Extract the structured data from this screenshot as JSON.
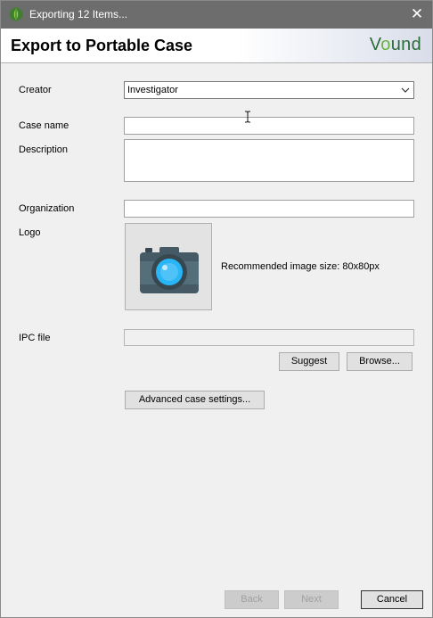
{
  "window": {
    "title": "Exporting 12 Items...",
    "close_glyph": "✕"
  },
  "header": {
    "title": "Export to Portable Case",
    "brand": {
      "prefix": "V",
      "o": "o",
      "suffix": "und"
    }
  },
  "form": {
    "creator": {
      "label": "Creator",
      "value": "Investigator"
    },
    "case_name": {
      "label": "Case name",
      "value": ""
    },
    "description": {
      "label": "Description",
      "value": ""
    },
    "organization": {
      "label": "Organization",
      "value": ""
    },
    "logo": {
      "label": "Logo",
      "hint": "Recommended image size: 80x80px",
      "icon": "camera-icon"
    },
    "ipc_file": {
      "label": "IPC file",
      "value": ""
    }
  },
  "buttons": {
    "suggest": "Suggest",
    "browse": "Browse...",
    "advanced": "Advanced case settings...",
    "back": "Back",
    "next": "Next",
    "cancel": "Cancel"
  },
  "colors": {
    "titlebar": "#6d6d6d",
    "brand_green": "#2a6b3a",
    "brand_accent": "#6bb33c",
    "camera_body": "#455a64",
    "camera_lens": "#29b6f6"
  }
}
